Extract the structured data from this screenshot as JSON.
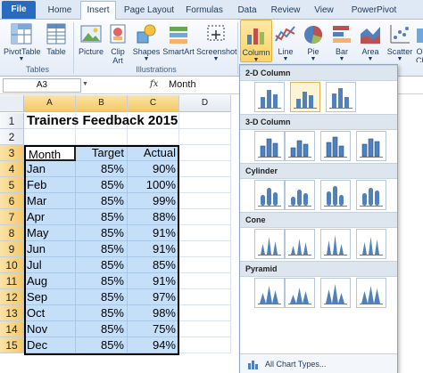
{
  "ribbon": {
    "tabs": [
      "File",
      "Home",
      "Insert",
      "Page Layout",
      "Formulas",
      "Data",
      "Review",
      "View",
      "PowerPivot"
    ],
    "active_tab": "Insert",
    "groups": {
      "tables": {
        "label": "Tables",
        "pivottable": "PivotTable",
        "table": "Table"
      },
      "illustrations": {
        "label": "Illustrations",
        "picture": "Picture",
        "clip_art_line1": "Clip",
        "clip_art_line2": "Art",
        "shapes": "Shapes",
        "smartart": "SmartArt",
        "screenshot": "Screenshot"
      },
      "charts": {
        "column": "Column",
        "line": "Line",
        "pie": "Pie",
        "bar": "Bar",
        "area": "Area",
        "scatter": "Scatter",
        "other_line1": "O",
        "other_line2": "Ch"
      }
    }
  },
  "formula_bar": {
    "name_box": "A3",
    "fx": "fx",
    "value": "Month"
  },
  "sheet": {
    "columns": [
      "A",
      "B",
      "C",
      "D"
    ],
    "rows": [
      "1",
      "2",
      "3",
      "4",
      "5",
      "6",
      "7",
      "8",
      "9",
      "10",
      "11",
      "12",
      "13",
      "14",
      "15"
    ],
    "title": "Trainers Feedback 2015",
    "table": {
      "headers": [
        "Month",
        "Target",
        "Actual"
      ],
      "data": [
        [
          "Jan",
          "85%",
          "90%"
        ],
        [
          "Feb",
          "85%",
          "100%"
        ],
        [
          "Mar",
          "85%",
          "99%"
        ],
        [
          "Apr",
          "85%",
          "88%"
        ],
        [
          "May",
          "85%",
          "91%"
        ],
        [
          "Jun",
          "85%",
          "91%"
        ],
        [
          "Jul",
          "85%",
          "85%"
        ],
        [
          "Aug",
          "85%",
          "91%"
        ],
        [
          "Sep",
          "85%",
          "97%"
        ],
        [
          "Oct",
          "85%",
          "98%"
        ],
        [
          "Nov",
          "85%",
          "75%"
        ],
        [
          "Dec",
          "85%",
          "94%"
        ]
      ]
    }
  },
  "column_dropdown": {
    "sections": [
      "2-D Column",
      "3-D Column",
      "Cylinder",
      "Cone",
      "Pyramid"
    ],
    "footer": "All Chart Types..."
  },
  "colors": {
    "selection": "#c5dff8",
    "file_tab": "#2a6bc2",
    "chart_icon": "#4f81bd",
    "highlight": "#fbd36b"
  }
}
